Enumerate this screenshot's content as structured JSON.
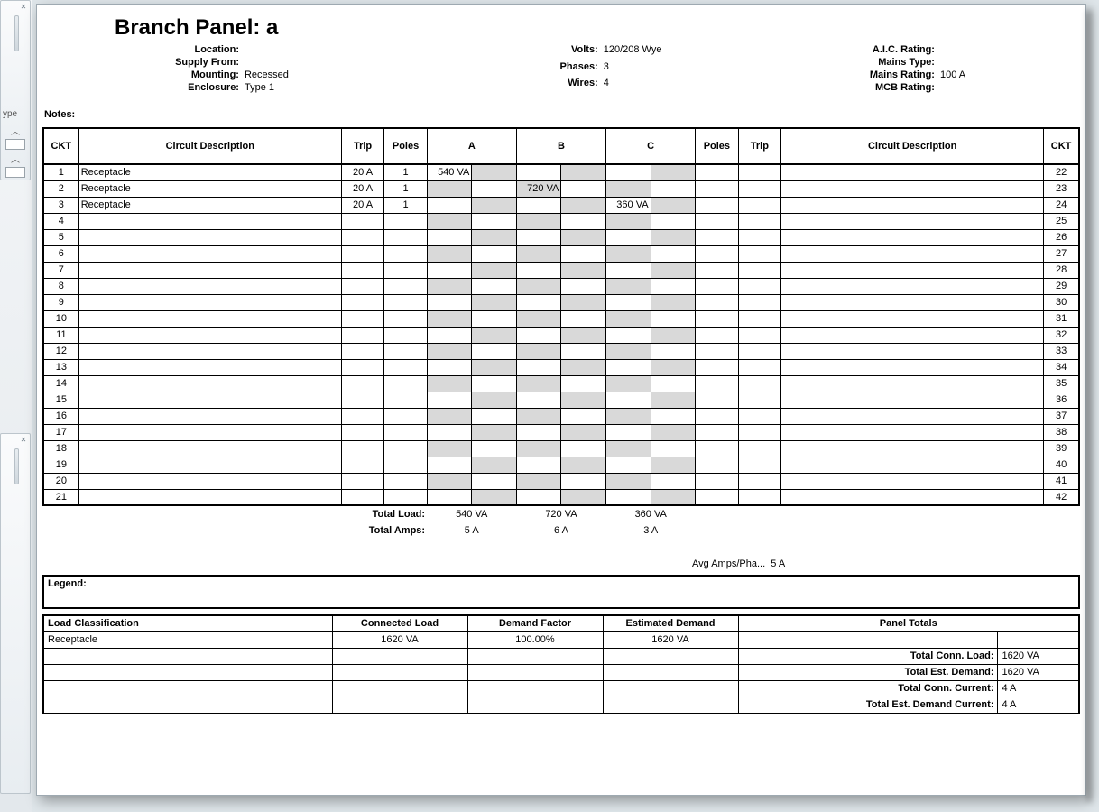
{
  "title": "Branch Panel: a",
  "header": {
    "col1": {
      "location_label": "Location:",
      "location_val": "",
      "supply_label": "Supply From:",
      "supply_val": "",
      "mount_label": "Mounting:",
      "mount_val": "Recessed",
      "encl_label": "Enclosure:",
      "encl_val": "Type 1"
    },
    "col2": {
      "volts_label": "Volts:",
      "volts_val": "120/208 Wye",
      "phases_label": "Phases:",
      "phases_val": "3",
      "wires_label": "Wires:",
      "wires_val": "4"
    },
    "col3": {
      "aic_label": "A.I.C. Rating:",
      "aic_val": "",
      "mt_label": "Mains Type:",
      "mt_val": "",
      "mr_label": "Mains Rating:",
      "mr_val": "100 A",
      "mcb_label": "MCB Rating:",
      "mcb_val": ""
    }
  },
  "notes_label": "Notes:",
  "sched_headers": {
    "ckt": "CKT",
    "desc": "Circuit Description",
    "trip": "Trip",
    "poles": "Poles",
    "A": "A",
    "B": "B",
    "C": "C"
  },
  "schedule_left": [
    {
      "ckt": "1",
      "desc": "Receptacle",
      "trip": "20 A",
      "poles": "1",
      "A": "540 VA",
      "B": "",
      "C": ""
    },
    {
      "ckt": "2",
      "desc": "Receptacle",
      "trip": "20 A",
      "poles": "1",
      "A": "",
      "B": "720 VA",
      "C": ""
    },
    {
      "ckt": "3",
      "desc": "Receptacle",
      "trip": "20 A",
      "poles": "1",
      "A": "",
      "B": "",
      "C": "360 VA"
    },
    {
      "ckt": "4"
    },
    {
      "ckt": "5"
    },
    {
      "ckt": "6"
    },
    {
      "ckt": "7"
    },
    {
      "ckt": "8"
    },
    {
      "ckt": "9"
    },
    {
      "ckt": "10"
    },
    {
      "ckt": "11"
    },
    {
      "ckt": "12"
    },
    {
      "ckt": "13"
    },
    {
      "ckt": "14"
    },
    {
      "ckt": "15"
    },
    {
      "ckt": "16"
    },
    {
      "ckt": "17"
    },
    {
      "ckt": "18"
    },
    {
      "ckt": "19"
    },
    {
      "ckt": "20"
    },
    {
      "ckt": "21"
    }
  ],
  "schedule_right": [
    {
      "ckt": "22"
    },
    {
      "ckt": "23"
    },
    {
      "ckt": "24"
    },
    {
      "ckt": "25"
    },
    {
      "ckt": "26"
    },
    {
      "ckt": "27"
    },
    {
      "ckt": "28"
    },
    {
      "ckt": "29"
    },
    {
      "ckt": "30"
    },
    {
      "ckt": "31"
    },
    {
      "ckt": "32"
    },
    {
      "ckt": "33"
    },
    {
      "ckt": "34"
    },
    {
      "ckt": "35"
    },
    {
      "ckt": "36"
    },
    {
      "ckt": "37"
    },
    {
      "ckt": "38"
    },
    {
      "ckt": "39"
    },
    {
      "ckt": "40"
    },
    {
      "ckt": "41"
    },
    {
      "ckt": "42"
    }
  ],
  "totals": {
    "load_label": "Total Load:",
    "amps_label": "Total Amps:",
    "load": {
      "A": "540 VA",
      "B": "720 VA",
      "C": "360 VA"
    },
    "amps": {
      "A": "5 A",
      "B": "6 A",
      "C": "3 A"
    },
    "avg_label": "Avg Amps/Pha...",
    "avg_val": "5 A"
  },
  "legend_label": "Legend:",
  "summary_headers": {
    "lc": "Load Classification",
    "cl": "Connected Load",
    "df": "Demand Factor",
    "ed": "Estimated Demand",
    "pt": "Panel Totals"
  },
  "summary_rows": [
    {
      "lc": "Receptacle",
      "cl": "1620 VA",
      "df": "100.00%",
      "ed": "1620 VA"
    }
  ],
  "panel_totals": [
    {
      "lbl": "Total Conn. Load:",
      "val": "1620 VA"
    },
    {
      "lbl": "Total Est. Demand:",
      "val": "1620 VA"
    },
    {
      "lbl": "Total Conn. Current:",
      "val": "4 A"
    },
    {
      "lbl": "Total Est. Demand Current:",
      "val": "4 A"
    }
  ],
  "rail_label": "ype"
}
